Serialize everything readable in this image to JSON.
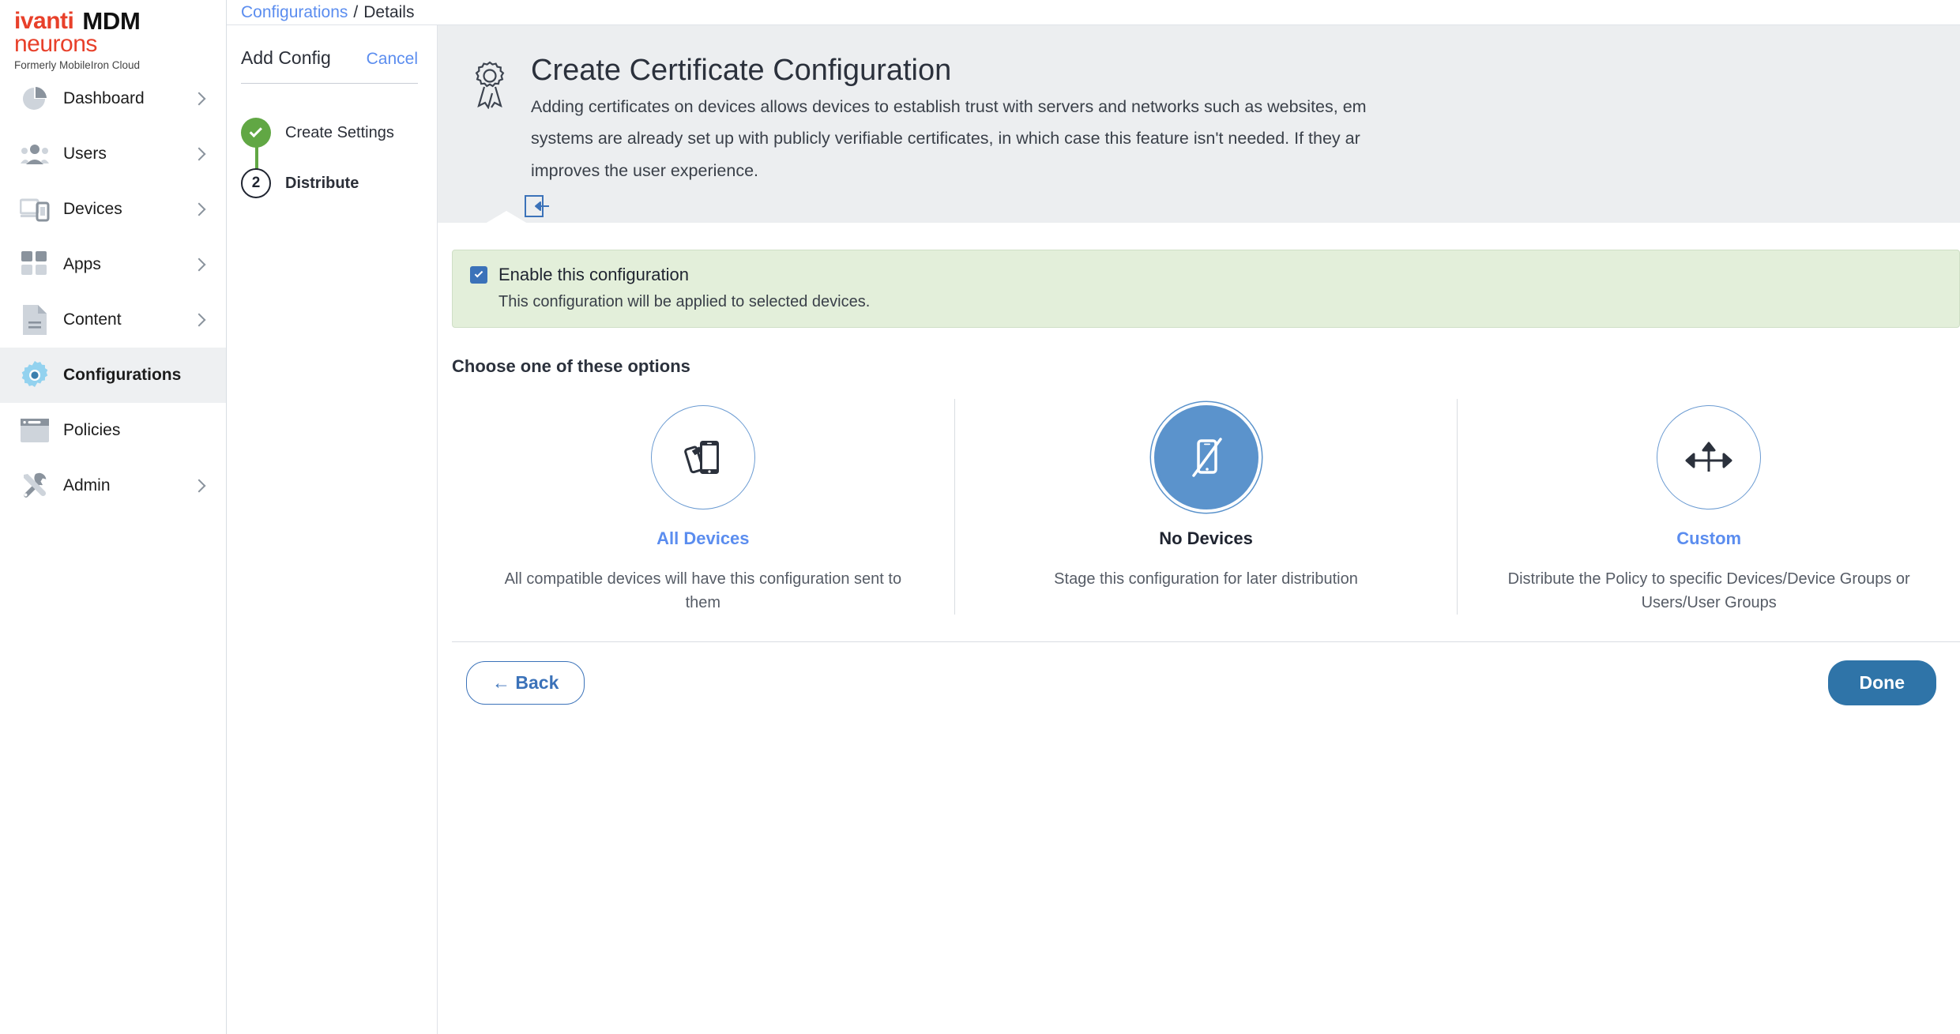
{
  "brand": {
    "name_primary": "ivanti",
    "name_secondary": "neurons",
    "product": "MDM",
    "tagline": "Formerly MobileIron Cloud",
    "accent_red": "#e8402a"
  },
  "sidebar": {
    "items": [
      {
        "label": "Dashboard",
        "icon": "pie-chart-icon",
        "active": false,
        "chevron": true
      },
      {
        "label": "Users",
        "icon": "people-icon",
        "active": false,
        "chevron": true
      },
      {
        "label": "Devices",
        "icon": "devices-icon",
        "active": false,
        "chevron": true
      },
      {
        "label": "Apps",
        "icon": "grid-apps-icon",
        "active": false,
        "chevron": true
      },
      {
        "label": "Content",
        "icon": "document-icon",
        "active": false,
        "chevron": true
      },
      {
        "label": "Configurations",
        "icon": "gear-icon",
        "active": true,
        "chevron": false
      },
      {
        "label": "Policies",
        "icon": "policy-window-icon",
        "active": false,
        "chevron": false
      },
      {
        "label": "Admin",
        "icon": "tools-icon",
        "active": false,
        "chevron": true
      }
    ]
  },
  "breadcrumb": {
    "root": "Configurations",
    "separator": "/",
    "current": "Details"
  },
  "wizard": {
    "title": "Add Config",
    "cancel_label": "Cancel",
    "steps": [
      {
        "number": "1",
        "label": "Create Settings",
        "state": "done"
      },
      {
        "number": "2",
        "label": "Distribute",
        "state": "current"
      }
    ]
  },
  "hero": {
    "icon": "certificate-ribbon-icon",
    "title": "Create Certificate Configuration",
    "description": "Adding certificates on devices allows devices to establish trust with servers and networks such as websites, email systems are already set up with publicly verifiable certificates, in which case this feature isn't needed. If they are improves the user experience.",
    "desc_line1": "Adding certificates on devices allows devices to establish trust with servers and networks such as websites, em",
    "desc_line2": "systems are already set up with publicly verifiable certificates, in which case this feature isn't needed. If they ar",
    "desc_line3": "improves the user experience.",
    "tool_icon": "collapse-left-icon",
    "accent_blue": "#3b72b9"
  },
  "enable_banner": {
    "checked": true,
    "title": "Enable this configuration",
    "subtitle": "This configuration will be applied to selected devices.",
    "background": "#e3efda",
    "checkbox_color": "#3b72b9"
  },
  "options": {
    "heading": "Choose one of these options",
    "cards": [
      {
        "title": "All Devices",
        "description": "All compatible devices will have this configuration sent to them",
        "icon": "two-phones-icon",
        "selected": false
      },
      {
        "title": "No Devices",
        "description": "Stage this configuration for later distribution",
        "icon": "phone-slash-icon",
        "selected": true
      },
      {
        "title": "Custom",
        "description": "Distribute the Policy to specific Devices/Device Groups or Users/User Groups",
        "icon": "branching-arrows-icon",
        "selected": false
      }
    ],
    "selected_color": "#5b93cc",
    "unselected_border": "#6b9bd2"
  },
  "footer": {
    "back_label": "Back",
    "back_icon": "arrow-left-icon",
    "done_label": "Done",
    "done_color": "#2f74a8"
  }
}
